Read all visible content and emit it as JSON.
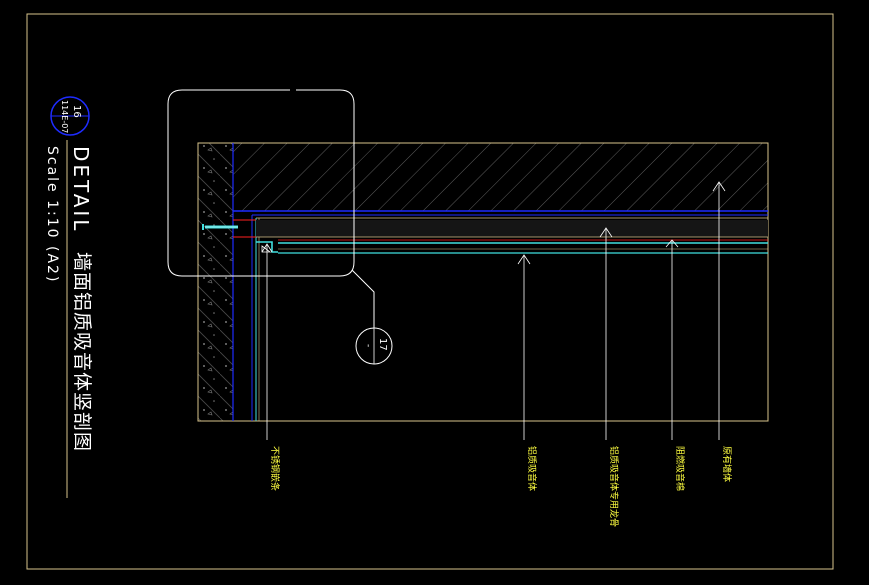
{
  "title_block": {
    "detail_number": "16",
    "sheet_ref": "114E-07",
    "title": "DETAIL",
    "scale": "Scale  1:10 (A2)",
    "name": "墙面铝质吸音体竖剖图"
  },
  "callout": {
    "number": "17",
    "sub": "-"
  },
  "labels": [
    {
      "text": "不锈钢嵌条"
    },
    {
      "text": "铝质吸音体"
    },
    {
      "text": "铝质吸音体专用龙骨"
    },
    {
      "text": "阻燃吸音棉"
    },
    {
      "text": "原有墙体"
    }
  ],
  "colors": {
    "background": "#000000",
    "frame": "#d8c38c",
    "hatch": "#6e6e6e",
    "blue": "#1e2cff",
    "cyan": "#40e0e0",
    "red": "#ff2020",
    "white": "#ffffff",
    "label_text": "#ffff40"
  }
}
